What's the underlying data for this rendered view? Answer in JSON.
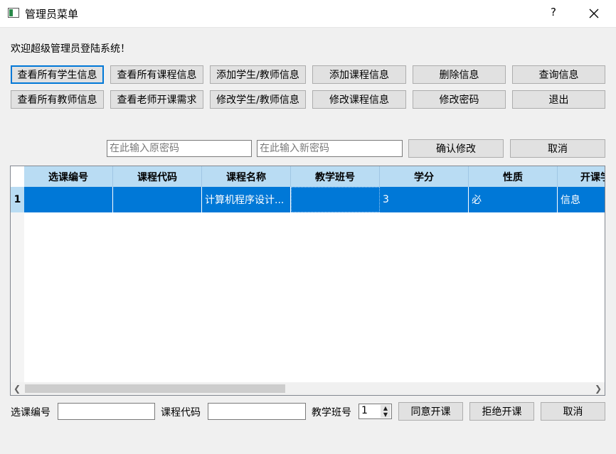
{
  "window": {
    "title": "管理员菜单",
    "help": "?"
  },
  "welcome": "欢迎超级管理员登陆系统！",
  "toolbar_row1": [
    "查看所有学生信息",
    "查看所有课程信息",
    "添加学生/教师信息",
    "添加课程信息",
    "删除信息",
    "查询信息"
  ],
  "toolbar_row2": [
    "查看所有教师信息",
    "查看老师开课需求",
    "修改学生/教师信息",
    "修改课程信息",
    "修改密码",
    "退出"
  ],
  "password": {
    "old_placeholder": "在此输入原密码",
    "new_placeholder": "在此输入新密码",
    "confirm_label": "确认修改",
    "cancel_label": "取消"
  },
  "table": {
    "columns": [
      "选课编号",
      "课程代码",
      "课程名称",
      "教学班号",
      "学分",
      "性质",
      "开课学"
    ],
    "rows": [
      {
        "num": "1",
        "cells": [
          "",
          "",
          "计算机程序设计...",
          "",
          "3",
          "必",
          "信息"
        ]
      }
    ]
  },
  "bottom": {
    "course_id_label": "选课编号",
    "course_id_value": "",
    "course_code_label": "课程代码",
    "course_code_value": "",
    "class_no_label": "教学班号",
    "class_no_value": "1",
    "approve_label": "同意开课",
    "reject_label": "拒绝开课",
    "cancel_label": "取消"
  },
  "colors": {
    "accent": "#0078d7",
    "header_bg": "#b9dcf3"
  }
}
